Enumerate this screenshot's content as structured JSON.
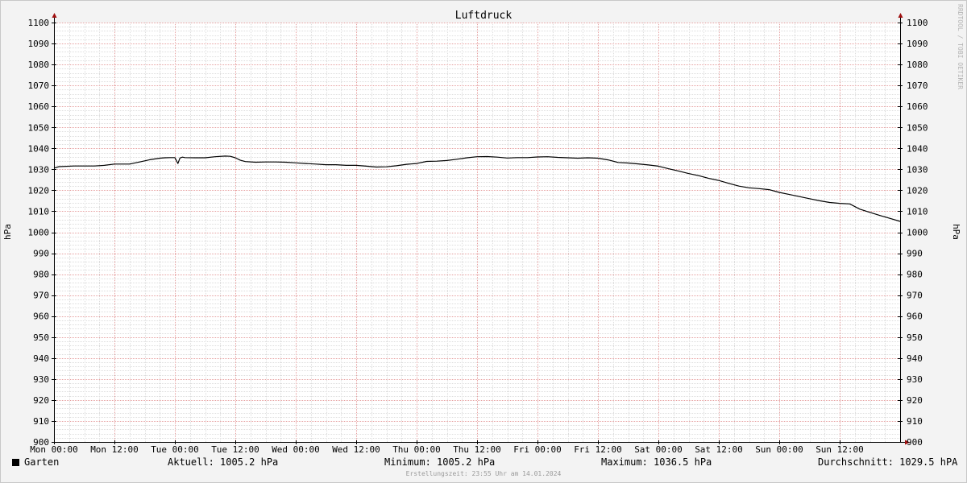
{
  "chart_data": {
    "type": "line",
    "title": "Luftdruck",
    "ylabel": "hPa",
    "ylabel_right": "hPa",
    "ylim": [
      900,
      1100
    ],
    "yticks": [
      900,
      910,
      920,
      930,
      940,
      950,
      960,
      970,
      980,
      990,
      1000,
      1010,
      1020,
      1030,
      1040,
      1050,
      1060,
      1070,
      1080,
      1090,
      1100
    ],
    "xlim": [
      0,
      168
    ],
    "xticks": [
      {
        "hour": 0,
        "label": "Mon 00:00"
      },
      {
        "hour": 12,
        "label": "Mon 12:00"
      },
      {
        "hour": 24,
        "label": "Tue 00:00"
      },
      {
        "hour": 36,
        "label": "Tue 12:00"
      },
      {
        "hour": 48,
        "label": "Wed 00:00"
      },
      {
        "hour": 60,
        "label": "Wed 12:00"
      },
      {
        "hour": 72,
        "label": "Thu 00:00"
      },
      {
        "hour": 84,
        "label": "Thu 12:00"
      },
      {
        "hour": 96,
        "label": "Fri 00:00"
      },
      {
        "hour": 108,
        "label": "Fri 12:00"
      },
      {
        "hour": 120,
        "label": "Sat 00:00"
      },
      {
        "hour": 132,
        "label": "Sat 12:00"
      },
      {
        "hour": 144,
        "label": "Sun 00:00"
      },
      {
        "hour": 156,
        "label": "Sun 12:00"
      }
    ],
    "grid": true,
    "series": [
      {
        "name": "Garten",
        "color": "#000000",
        "x": [
          0,
          1,
          4,
          8,
          10,
          12,
          15,
          17,
          19,
          21,
          22,
          23,
          24,
          24.6,
          25,
          25.5,
          26,
          28,
          30,
          32,
          34,
          35,
          36,
          37,
          38,
          40,
          42,
          44,
          46,
          48,
          50,
          52,
          54,
          56,
          58,
          60,
          62,
          64,
          66,
          68,
          70,
          72,
          74,
          76,
          78,
          80,
          82,
          84,
          86,
          88,
          90,
          92,
          94,
          96,
          98,
          100,
          102,
          104,
          106,
          108,
          110,
          112,
          114,
          116,
          118,
          120,
          122,
          124,
          126,
          128,
          130,
          132,
          134,
          136,
          138,
          140,
          142,
          144,
          146,
          148,
          150,
          152,
          154,
          156,
          158,
          160,
          162,
          164,
          166,
          168
        ],
        "y": [
          1030.6,
          1031.3,
          1031.6,
          1031.6,
          1031.9,
          1032.5,
          1032.5,
          1033.5,
          1034.6,
          1035.3,
          1035.5,
          1035.6,
          1035.6,
          1032.8,
          1035.4,
          1035.8,
          1035.6,
          1035.5,
          1035.5,
          1036.0,
          1036.3,
          1036.2,
          1035.5,
          1034.3,
          1033.7,
          1033.4,
          1033.5,
          1033.5,
          1033.4,
          1033.1,
          1032.8,
          1032.5,
          1032.2,
          1032.2,
          1031.9,
          1031.9,
          1031.5,
          1031.1,
          1031.2,
          1031.7,
          1032.4,
          1032.8,
          1033.8,
          1033.9,
          1034.2,
          1034.8,
          1035.5,
          1036.0,
          1036.1,
          1035.8,
          1035.4,
          1035.6,
          1035.6,
          1035.9,
          1036.0,
          1035.7,
          1035.5,
          1035.3,
          1035.5,
          1035.3,
          1034.5,
          1033.3,
          1033.0,
          1032.6,
          1032.1,
          1031.5,
          1030.3,
          1029.2,
          1028.0,
          1027.0,
          1025.7,
          1024.7,
          1023.3,
          1022.0,
          1021.2,
          1020.8,
          1020.3,
          1019.0,
          1018.0,
          1017.0,
          1016.0,
          1015.0,
          1014.2,
          1013.8,
          1013.5,
          1011.0,
          1009.5,
          1008.0,
          1006.6,
          1005.2
        ]
      }
    ]
  },
  "legend": {
    "series_name": "Garten",
    "current": "Aktuell: 1005.2 hPa",
    "minimum": "Minimum: 1005.2 hPa",
    "maximum": "Maximum: 1036.5 hPa",
    "average": "Durchschnitt: 1029.5 hPA"
  },
  "watermark": "RRDTOOL / TOBI OETIKER",
  "footer": "Erstellungszeit: 23:55 Uhr am 14.01.2024",
  "colors": {
    "plot_background": "#ffffff",
    "minor_grid": "#dddddd",
    "major_grid": "#e6a0a0",
    "line": "#000000",
    "axis_arrow": "#a01010"
  }
}
